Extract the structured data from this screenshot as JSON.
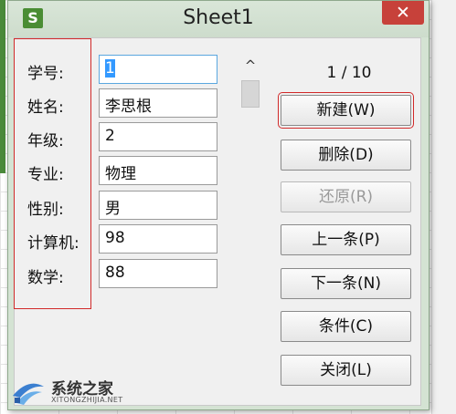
{
  "window": {
    "title": "Sheet1",
    "app_icon_letter": "S",
    "close_glyph": "✕"
  },
  "form": {
    "fields": [
      {
        "label": "学号:",
        "value": "1"
      },
      {
        "label": "姓名:",
        "value": "李思根"
      },
      {
        "label": "年级:",
        "value": "2"
      },
      {
        "label": "专业:",
        "value": "物理"
      },
      {
        "label": "性别:",
        "value": "男"
      },
      {
        "label": "计算机:",
        "value": "98"
      },
      {
        "label": "数学:",
        "value": "88"
      }
    ]
  },
  "navigation": {
    "record_counter": "1 / 10",
    "scroll_up_glyph": "^"
  },
  "buttons": {
    "new": "新建(W)",
    "delete": "删除(D)",
    "restore": "还原(R)",
    "prev": "上一条(P)",
    "next": "下一条(N)",
    "criteria": "条件(C)",
    "close": "关闭(L)"
  },
  "watermark": {
    "name": "系统之家",
    "url": "XITONGZHIJIA.NET"
  },
  "colors": {
    "window_frame": "#d4e3d3",
    "close_button": "#c7413a",
    "app_icon": "#4a8d34",
    "annotation_red": "#d12a2a",
    "selection_blue": "#3399ff"
  }
}
